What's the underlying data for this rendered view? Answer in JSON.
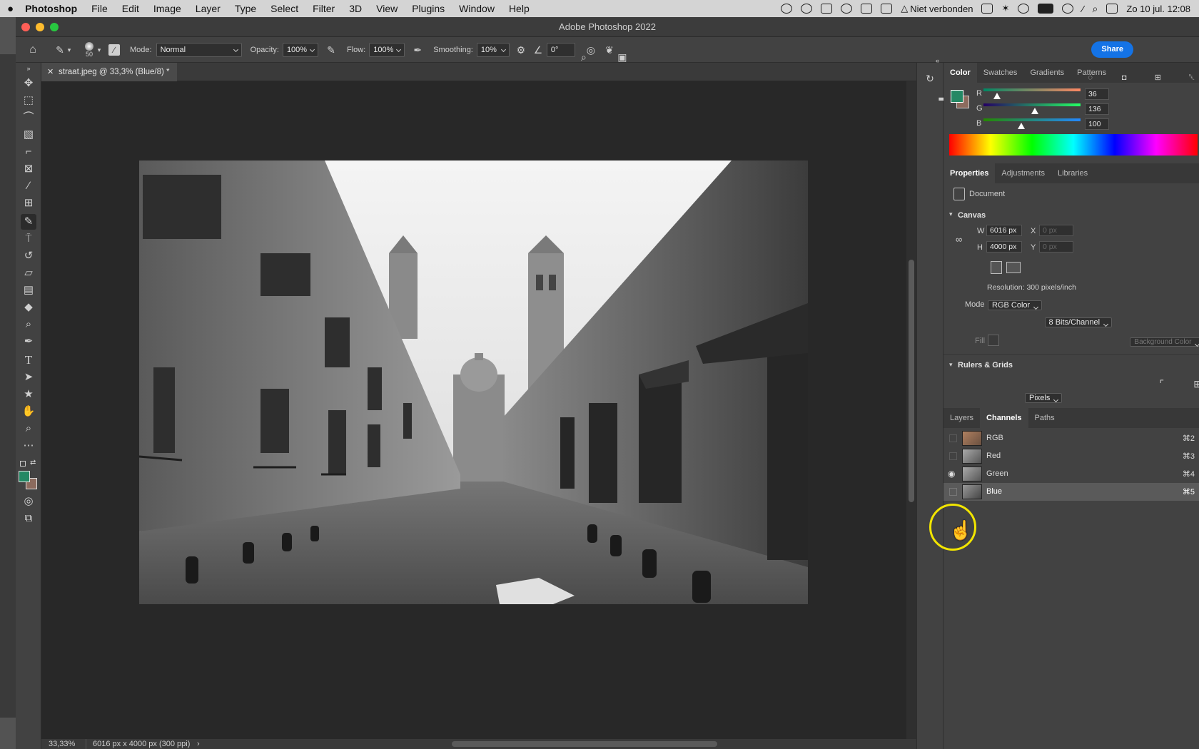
{
  "menubar": {
    "apple": "",
    "app": "Photoshop",
    "items": [
      "File",
      "Edit",
      "Image",
      "Layer",
      "Type",
      "Select",
      "Filter",
      "3D",
      "View",
      "Plugins",
      "Window",
      "Help"
    ],
    "network_status": "Niet verbonden",
    "datetime": "Zo 10 jul.  12:08"
  },
  "window": {
    "title": "Adobe Photoshop 2022"
  },
  "options": {
    "brush_size": "50",
    "mode_label": "Mode:",
    "mode_value": "Normal",
    "opacity_label": "Opacity:",
    "opacity_value": "100%",
    "flow_label": "Flow:",
    "flow_value": "100%",
    "smoothing_label": "Smoothing:",
    "smoothing_value": "10%",
    "angle_value": "0°",
    "share_label": "Share"
  },
  "document": {
    "tab_title": "straat.jpeg @ 33,3% (Blue/8) *",
    "zoom": "33,33%",
    "info": "6016 px x 4000 px (300 ppi)"
  },
  "color_panel": {
    "tabs": [
      "Color",
      "Swatches",
      "Gradients",
      "Patterns"
    ],
    "r_label": "R",
    "g_label": "G",
    "b_label": "B",
    "r": "36",
    "g": "136",
    "b": "100",
    "r_fraction": 0.141,
    "g_fraction": 0.533,
    "b_fraction": 0.392,
    "foreground": "#248864",
    "background": "#8c6b5e"
  },
  "properties": {
    "tabs": [
      "Properties",
      "Adjustments",
      "Libraries"
    ],
    "doc_label": "Document",
    "canvas_title": "Canvas",
    "w_label": "W",
    "w": "6016 px",
    "h_label": "H",
    "h": "4000 px",
    "x_label": "X",
    "x_placeholder": "0 px",
    "y_label": "Y",
    "y_placeholder": "0 px",
    "resolution": "Resolution: 300 pixels/inch",
    "mode_label": "Mode",
    "mode_value": "RGB Color",
    "bits_value": "8 Bits/Channel",
    "fill_label": "Fill",
    "fill_value": "Background Color",
    "rulers_title": "Rulers & Grids",
    "units_value": "Pixels"
  },
  "channels": {
    "tabs": [
      "Layers",
      "Channels",
      "Paths"
    ],
    "rows": [
      {
        "name": "RGB",
        "shortcut": "⌘2"
      },
      {
        "name": "Red",
        "shortcut": "⌘3"
      },
      {
        "name": "Green",
        "shortcut": "⌘4"
      },
      {
        "name": "Blue",
        "shortcut": "⌘5"
      }
    ]
  },
  "colors": {
    "accent": "#1473e6",
    "panel": "#424242",
    "canvas": "#282828"
  }
}
